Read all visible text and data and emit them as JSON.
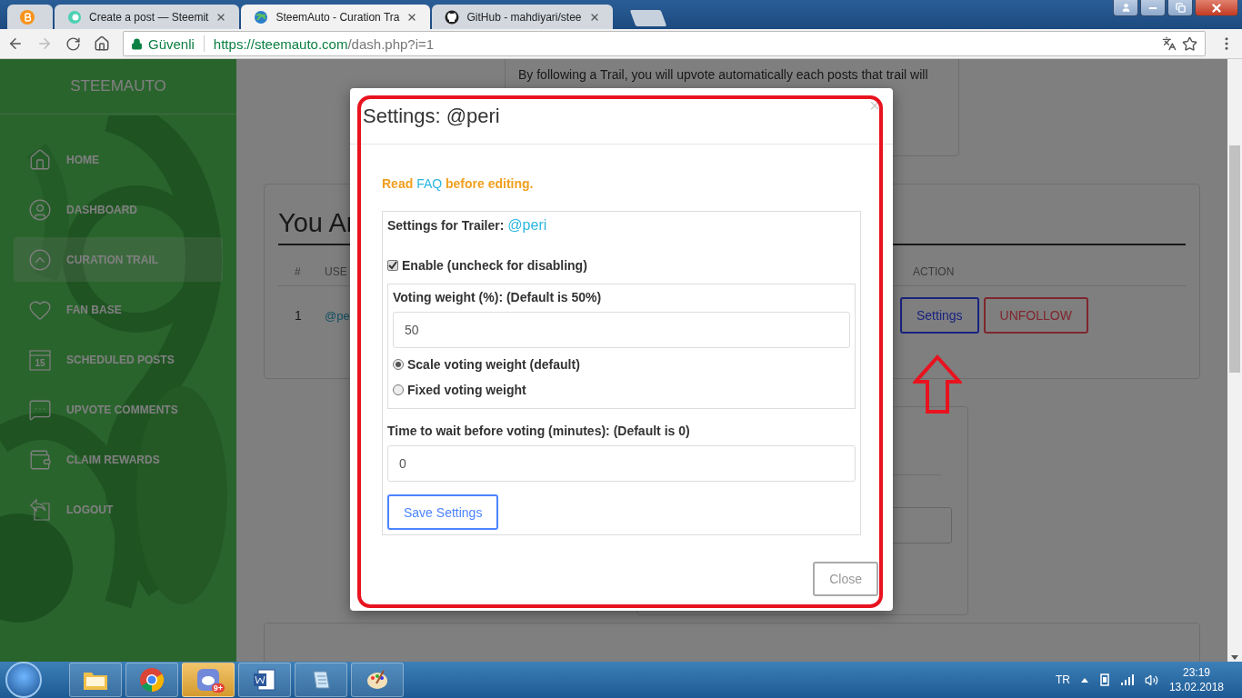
{
  "browser": {
    "tabs": [
      {
        "selected": false
      },
      {
        "title": "Create a post — Steemit",
        "selected": false
      },
      {
        "title": "SteemAuto - Curation Tra",
        "selected": true
      },
      {
        "title": "GitHub - mahdiyari/stee",
        "selected": false
      }
    ],
    "secure_label": "Güvenli",
    "url_host": "https://steemauto.com",
    "url_path": "/dash.php?i=1"
  },
  "sidebar": {
    "brand": "STEEMAUTO",
    "items": [
      {
        "label": "HOME",
        "selected": false
      },
      {
        "label": "DASHBOARD",
        "selected": false
      },
      {
        "label": "CURATION TRAIL",
        "selected": true
      },
      {
        "label": "FAN BASE",
        "selected": false
      },
      {
        "label": "SCHEDULED POSTS",
        "selected": false,
        "calendar_day": "15"
      },
      {
        "label": "UPVOTE COMMENTS",
        "selected": false
      },
      {
        "label": "CLAIM REWARDS",
        "selected": false
      },
      {
        "label": "LOGOUT",
        "selected": false
      }
    ]
  },
  "page": {
    "intro_text": "By following a Trail, you will upvote automatically each posts that trail will",
    "following": {
      "heading": "You Ar",
      "columns": [
        "#",
        "USE",
        "ACTION"
      ],
      "rows": [
        {
          "index": "1",
          "user": "@pe"
        }
      ],
      "actions": [
        "Settings",
        "UNFOLLOW"
      ]
    }
  },
  "modal": {
    "title": "Settings: @peri",
    "close_glyph": "×",
    "notice_before": "Read",
    "notice_link": "FAQ",
    "notice_after": "before editing.",
    "trailer_label": "Settings for Trailer:",
    "trailer_link": "@peri",
    "enable": {
      "label": "Enable (uncheck for disabling)",
      "checked": true
    },
    "weight_label": "Voting weight (%): (Default is 50%)",
    "weight_value": "50",
    "weight_modes": [
      {
        "label": "Scale voting weight (default)",
        "selected": true
      },
      {
        "label": "Fixed voting weight",
        "selected": false
      }
    ],
    "wait_label": "Time to wait before voting (minutes): (Default is 0)",
    "wait_value": "0",
    "save_button": "Save Settings",
    "close_button": "Close"
  },
  "taskbar": {
    "badge": "9+",
    "language": "TR",
    "time": "23:19",
    "date": "13.02.2018"
  }
}
